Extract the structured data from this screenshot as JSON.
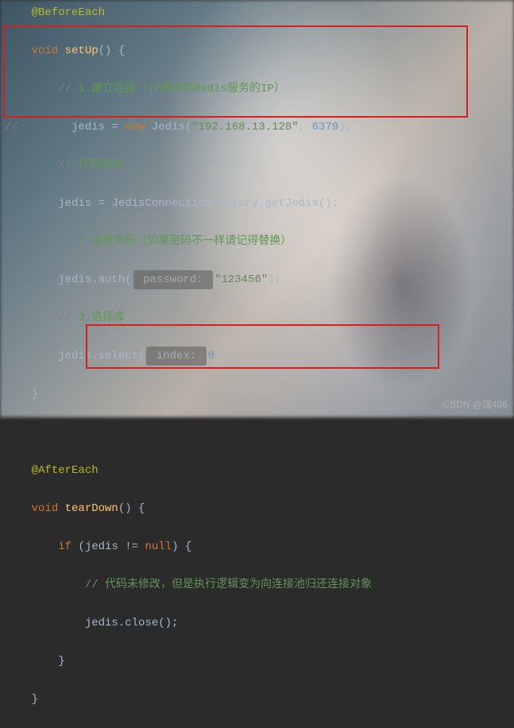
{
  "code": {
    "annotation1": "@BeforeEach",
    "kw_void1": "void",
    "method_setup": "setUp",
    "paren_open": "() {",
    "cmt1_a": "// ",
    "cmt1_b": "1.建立连接（IP换成你Redis服务的IP）",
    "cmt2_prefix": "//",
    "assign_old_a": "jedis = ",
    "kw_new": "new",
    "ctor": " Jedis(",
    "ip": "\"192.168.13.128\"",
    "comma": ", ",
    "port": "6379",
    "close_paren_semi": ");",
    "cmt3_a": "// ",
    "cmt3_b": "代码改造",
    "assign_new_a": "jedis = ",
    "factory": "JedisConnectionFactory",
    "dot": ".",
    "getjedis": "getJedis",
    "call_end": "();",
    "cmt4_a": "// ",
    "cmt4_b": "2.设置密码（如果密码不一样请记得替换）",
    "auth_a": "jedis.auth(",
    "hint_pwd": " password: ",
    "pwd": "\"123456\"",
    "auth_end": ");",
    "cmt5_a": "// ",
    "cmt5_b": "3.选择库",
    "select_a": "jedis.select(",
    "hint_idx": " index: ",
    "zero": "0",
    "select_end": ");",
    "brace_close": "}",
    "annotation2": "@AfterEach",
    "kw_void2": "void",
    "method_teardown": "tearDown",
    "if_kw": "if",
    "if_cond_a": " (jedis != ",
    "null_kw": "null",
    "if_cond_b": ") {",
    "cmt6_a": "// ",
    "cmt6_b": "代码未修改，但是执行逻辑变为向连接池归还连接对象",
    "close_call": "jedis.close();"
  },
  "watermark": "CSDN @瑞486"
}
